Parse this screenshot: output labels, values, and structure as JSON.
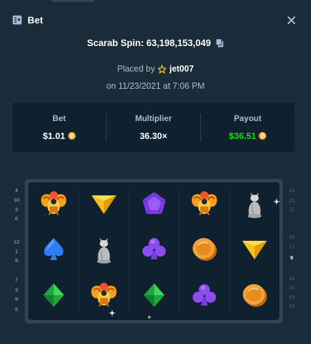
{
  "header": {
    "title": "Bet",
    "icon": "bet-slip-icon",
    "close_icon": "close-icon"
  },
  "game": {
    "id_text": "Scarab Spin: 63,198,153,049",
    "copy_icon": "copy-icon"
  },
  "placed": {
    "prefix": "Placed by",
    "user": "jet007",
    "user_icon": "star-icon",
    "date": "on 11/23/2021 at 7:06 PM"
  },
  "stats": {
    "bet_label": "Bet",
    "bet_value": "$1.01",
    "multiplier_label": "Multiplier",
    "multiplier_value": "36.30×",
    "payout_label": "Payout",
    "payout_value": "$36.51",
    "currency_icon": "bitcoin-icon",
    "payout_color": "#00e701"
  },
  "board": {
    "rows": [
      [
        "scarab",
        "yellow-triangle",
        "purple-pentagon",
        "scarab",
        "cat-statue"
      ],
      [
        "blue-spade",
        "cat-statue",
        "purple-club",
        "gold-coin",
        "yellow-triangle"
      ],
      [
        "green-diamond",
        "scarab",
        "green-diamond",
        "purple-club",
        "gold-coin"
      ]
    ]
  },
  "paylines": {
    "left": [
      "4",
      "10",
      "2",
      "6",
      "12",
      "1",
      "8",
      "7",
      "3",
      "9",
      "5"
    ],
    "right": [
      "15",
      "13",
      "11",
      "16",
      "17",
      "9",
      "18",
      "20",
      "19",
      "14"
    ],
    "highlight_right": "9"
  }
}
